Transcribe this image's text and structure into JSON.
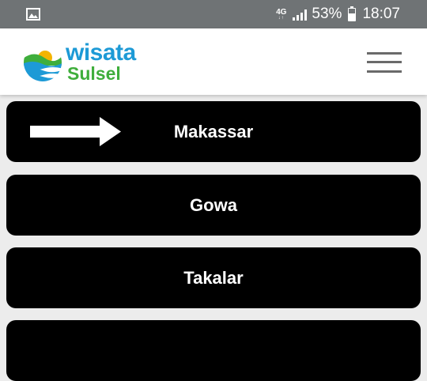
{
  "status_bar": {
    "network_main": "4G",
    "network_sub": "↓↑",
    "battery_percent": "53%",
    "time": "18:07",
    "icons": [
      "image-icon",
      "signal-icon",
      "battery-icon"
    ]
  },
  "header": {
    "logo_text_primary": "wisata",
    "logo_text_secondary": "Sulsel",
    "menu_icon": "hamburger-menu-icon"
  },
  "regions": [
    {
      "label": "Makassar",
      "highlighted": true
    },
    {
      "label": "Gowa",
      "highlighted": false
    },
    {
      "label": "Takalar",
      "highlighted": false
    }
  ],
  "colors": {
    "status_bar": "#6f7375",
    "button_bg": "#000000",
    "logo_blue": "#1d9ad6",
    "logo_green": "#3fae3c"
  }
}
